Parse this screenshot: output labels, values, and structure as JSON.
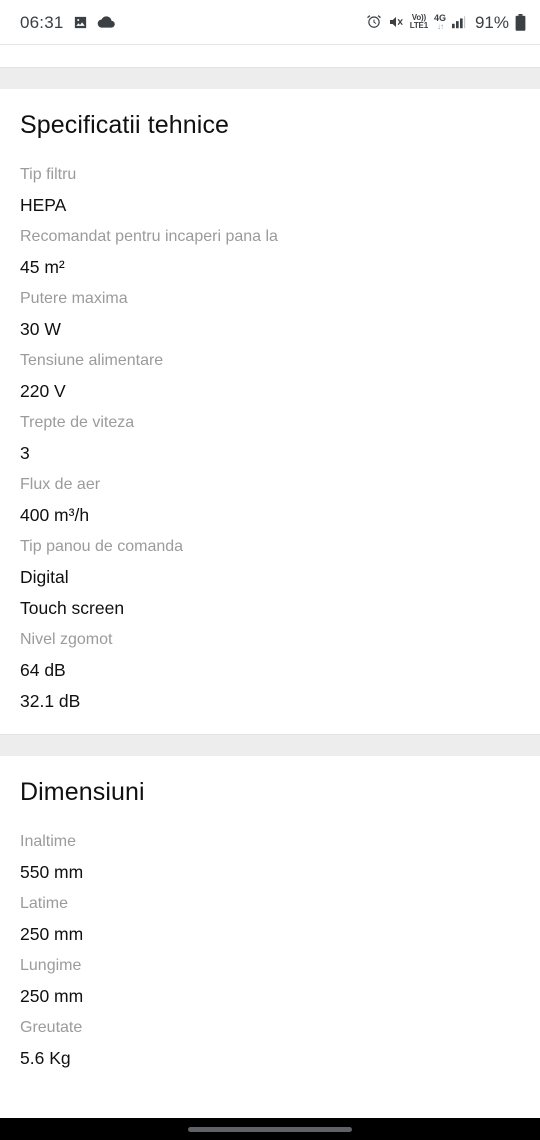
{
  "status_bar": {
    "time": "06:31",
    "left_icons": [
      "image-icon",
      "cloud-icon"
    ],
    "right_icons": [
      "alarm-icon",
      "mute-icon",
      "volte-icon",
      "network-4g-icon",
      "signal-bars-icon"
    ],
    "volte_top": "Vo))",
    "volte_bottom": "LTE1",
    "network_label": "4G",
    "network_arrows": "↓↑",
    "battery_percent": "91%"
  },
  "sections": [
    {
      "title": "Specificatii tehnice",
      "rows": [
        {
          "label": "Tip filtru",
          "values": [
            "HEPA"
          ]
        },
        {
          "label": "Recomandat pentru incaperi pana la",
          "values": [
            "45 m²"
          ]
        },
        {
          "label": "Putere maxima",
          "values": [
            "30 W"
          ]
        },
        {
          "label": "Tensiune alimentare",
          "values": [
            "220 V"
          ]
        },
        {
          "label": "Trepte de viteza",
          "values": [
            "3"
          ]
        },
        {
          "label": "Flux de aer",
          "values": [
            "400 m³/h"
          ]
        },
        {
          "label": "Tip panou de comanda",
          "values": [
            "Digital",
            "Touch screen"
          ]
        },
        {
          "label": "Nivel zgomot",
          "values": [
            "64 dB",
            "32.1 dB"
          ]
        }
      ]
    },
    {
      "title": "Dimensiuni",
      "rows": [
        {
          "label": "Inaltime",
          "values": [
            "550 mm"
          ]
        },
        {
          "label": "Latime",
          "values": [
            "250 mm"
          ]
        },
        {
          "label": "Lungime",
          "values": [
            "250 mm"
          ]
        },
        {
          "label": "Greutate",
          "values": [
            "5.6 Kg"
          ]
        }
      ]
    }
  ],
  "nav_bar": {
    "home_indicator": "home-indicator"
  },
  "colors": {
    "label_gray": "#9b9b9b",
    "value_black": "#101010",
    "band_gray": "#ededed",
    "nav_black": "#000000",
    "pill_gray": "#5f6368"
  }
}
